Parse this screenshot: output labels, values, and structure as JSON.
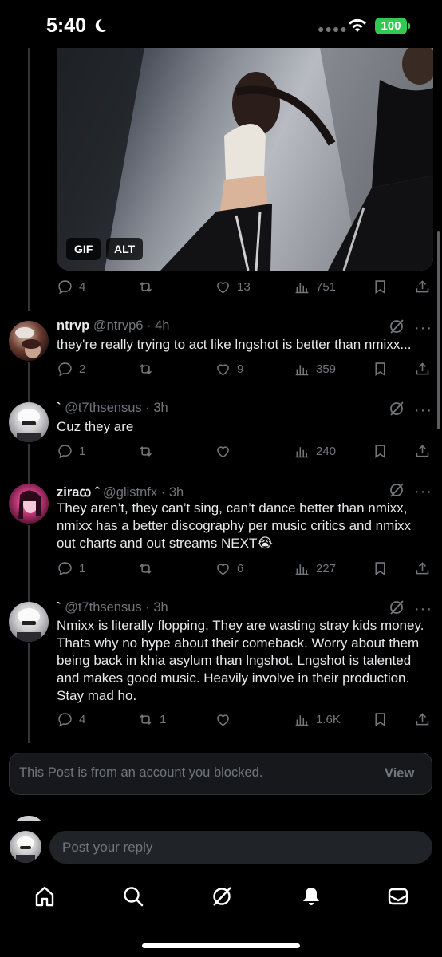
{
  "status_bar": {
    "time": "5:40",
    "battery": "100"
  },
  "media": {
    "gif_badge": "GIF",
    "alt_badge": "ALT"
  },
  "post0": {
    "replies": "4",
    "reposts": "",
    "likes": "13",
    "views": "751"
  },
  "posts": [
    {
      "name": "ntrvp",
      "handle": "@ntrvp6",
      "time": "4h",
      "text": "they're really trying to act like lngshot is better than nmixx...",
      "replies": "2",
      "reposts": "",
      "likes": "9",
      "views": "359"
    },
    {
      "name": "`",
      "handle": "@t7thsensus",
      "time": "3h",
      "text": "Cuz they are",
      "replies": "1",
      "reposts": "",
      "likes": "",
      "views": "240"
    },
    {
      "name": "ziraꞷ ˆ",
      "handle": "@glistnfx",
      "time": "3h",
      "text": "They aren’t, they can’t sing, can’t dance better than nmixx, nmixx has a better discography per music critics and nmixx out charts and out streams NEXT😭",
      "replies": "1",
      "reposts": "",
      "likes": "6",
      "views": "227"
    },
    {
      "name": "`",
      "handle": "@t7thsensus",
      "time": "3h",
      "text": "Nmixx is literally flopping. They are wasting stray kids money. Thats why no hype about their comeback. Worry about them being back in khia asylum than lngshot. Lngshot is talented and makes good music. Heavily involve in their production. Stay mad ho.",
      "replies": "4",
      "reposts": "1",
      "likes": "",
      "views": "1.6K"
    }
  ],
  "blocked": {
    "text": "This Post is from an account you blocked.",
    "view_label": "View"
  },
  "reply": {
    "placeholder": "Post your reply"
  },
  "nav": [
    "home-icon",
    "search-icon",
    "grok-icon",
    "notifications-icon",
    "messages-icon"
  ],
  "colors": {
    "background": "#000000",
    "muted": "#71767b",
    "text": "#e7e9ea",
    "battery": "#31c950"
  }
}
